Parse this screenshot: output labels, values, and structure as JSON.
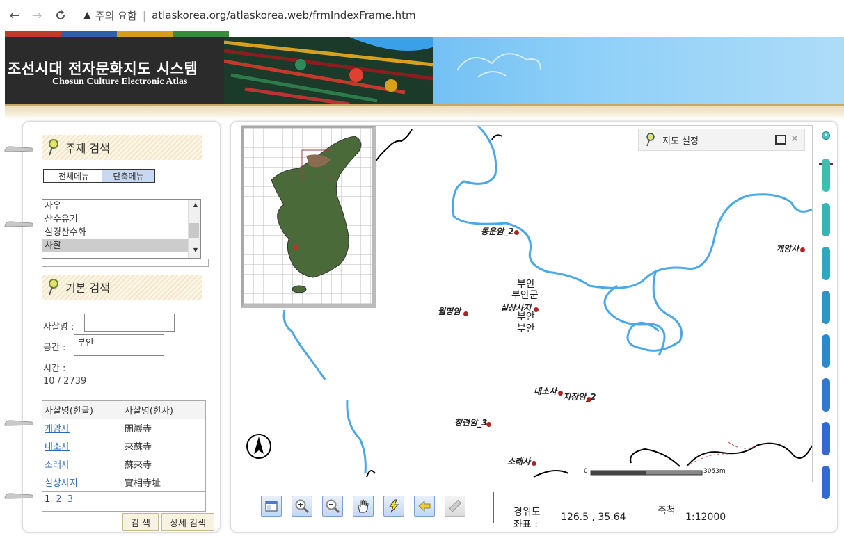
{
  "browser": {
    "back_icon": "←",
    "forward_icon": "→",
    "reload_icon": "C",
    "warning_icon": "▲",
    "security_label": "주의 요함",
    "separator": "|",
    "url": "atlaskorea.org/atlaskorea.web/frmIndexFrame.htm"
  },
  "header": {
    "title_ko": "조선시대 전자문화지도 시스템",
    "title_en": "Chosun Culture Electronic Atlas",
    "strip_colors": [
      "#c0392b",
      "#2f5fa8",
      "#d4a017",
      "#3a8a3a"
    ]
  },
  "left": {
    "theme_search_label": "주제 검색",
    "full_menu_label": "전체메뉴",
    "short_menu_label": "단축메뉴",
    "list_items": [
      "사우",
      "산수유기",
      "실경산수화",
      "사찰"
    ],
    "list_selected": "사찰",
    "basic_search_label": "기본 검색",
    "temple_name_label": "사찰명 :",
    "temple_name_value": "",
    "space_label": "공간 :",
    "space_value": "부안",
    "time_label": "시간 :",
    "time_value": "",
    "count": "10 / 2739",
    "table_headers": [
      "사찰명(한글)",
      "사찰명(한자)"
    ],
    "table_rows": [
      {
        "ko": "개암사",
        "hanja": "開巖寺"
      },
      {
        "ko": "내소사",
        "hanja": "來蘇寺"
      },
      {
        "ko": "소래사",
        "hanja": "蘇來寺"
      },
      {
        "ko": "실상사지",
        "hanja": "實相寺址"
      }
    ],
    "pager_current": "1",
    "pager_links": [
      "2",
      "3"
    ],
    "search_button": "검 색",
    "detail_search_button": "상세 검색"
  },
  "map": {
    "settings_label": "지도 설정",
    "labels": [
      {
        "text": "동운암_2",
        "kind": "site"
      },
      {
        "text": "개암사",
        "kind": "site"
      },
      {
        "text": "월명암",
        "kind": "site"
      },
      {
        "text": "실상사지",
        "kind": "site"
      },
      {
        "text": "내소사",
        "kind": "site"
      },
      {
        "text": "지장암_2",
        "kind": "site"
      },
      {
        "text": "청련암_3",
        "kind": "site"
      },
      {
        "text": "소래사",
        "kind": "site"
      }
    ],
    "admin_labels": [
      "부안",
      "부안군",
      "부안",
      "부안"
    ],
    "scale_start": "0",
    "scale_end": "3053m",
    "colors": {
      "river": "#4aa8e8",
      "site": "#b22222",
      "coast": "#000000"
    }
  },
  "toolbar": {
    "coords_label": "경위도",
    "coords_label2": "좌표 :",
    "coords_value": "126.5 , 35.64",
    "scale_label": "축척",
    "scale_value": "1:12000",
    "tools": [
      "full-extent",
      "zoom-in",
      "zoom-out",
      "pan",
      "lightning",
      "back-arrow",
      "measure"
    ]
  },
  "sidebar": {
    "colors": [
      "#3bbfb0",
      "#34b5b8",
      "#2ea8c0",
      "#2a98c6",
      "#2c88cc",
      "#3078d0",
      "#3468d4"
    ]
  }
}
